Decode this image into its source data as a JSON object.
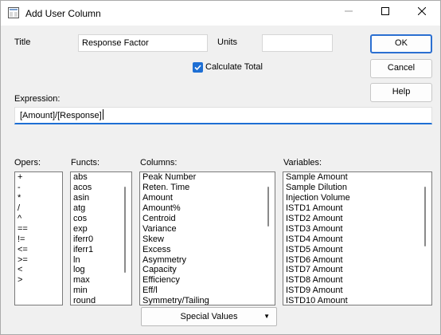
{
  "window": {
    "title": "Add User Column"
  },
  "fields": {
    "title_label": "Title",
    "title_value": "Response Factor",
    "units_label": "Units",
    "units_value": "",
    "calc_total_label": "Calculate Total",
    "calc_total_checked": true,
    "expression_label": "Expression:",
    "expression_value": "[Amount]/[Response]"
  },
  "buttons": {
    "ok": "OK",
    "cancel": "Cancel",
    "help": "Help",
    "special_values": "Special Values"
  },
  "lists": {
    "opers_label": "Opers:",
    "opers": [
      "+",
      "-",
      "*",
      "/",
      "^",
      "==",
      "!=",
      "<=",
      ">=",
      "<",
      ">"
    ],
    "functs_label": "Functs:",
    "functs": [
      "abs",
      "acos",
      "asin",
      "atg",
      "cos",
      "exp",
      "iferr0",
      "iferr1",
      "ln",
      "log",
      "max",
      "min",
      "round"
    ],
    "columns_label": "Columns:",
    "columns": [
      "Peak Number",
      "Reten. Time",
      "Amount",
      "Amount%",
      "Centroid",
      "Variance",
      "Skew",
      "Excess",
      "Asymmetry",
      "Capacity",
      "Efficiency",
      "Eff/l",
      "Symmetry/Tailing"
    ],
    "variables_label": "Variables:",
    "variables": [
      "Sample Amount",
      "Sample Dilution",
      "Injection Volume",
      "ISTD1 Amount",
      "ISTD2 Amount",
      "ISTD3 Amount",
      "ISTD4 Amount",
      "ISTD5 Amount",
      "ISTD6 Amount",
      "ISTD7 Amount",
      "ISTD8 Amount",
      "ISTD9 Amount",
      "ISTD10 Amount"
    ]
  },
  "colors": {
    "accent": "#1e6fd4"
  }
}
